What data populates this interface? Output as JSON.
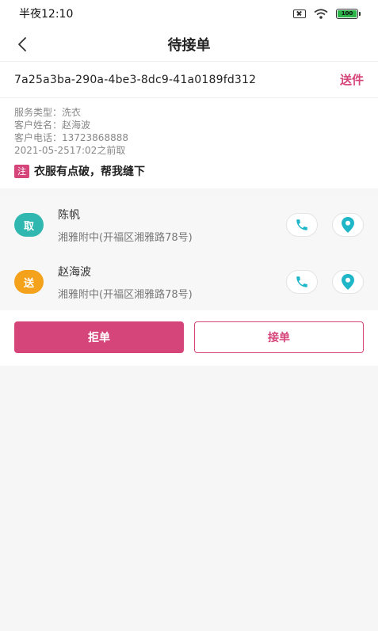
{
  "status_bar": {
    "time": "半夜12:10",
    "battery_level": 100,
    "battery_label": "100"
  },
  "header": {
    "title": "待接单"
  },
  "order": {
    "id": "7a25a3ba-290a-4be3-8dc9-41a0189fd312",
    "type": "送件",
    "service_type": "服务类型：洗衣",
    "customer_name": "客户姓名：赵海波",
    "customer_phone": "客户电话：13723868888",
    "deadline": "2021-05-2517:02之前取",
    "note_tag": "注",
    "note": "衣服有点破，帮我缝下"
  },
  "contacts": [
    {
      "badge": "取",
      "name": "陈帆",
      "address": "湘雅附中(开福区湘雅路78号)"
    },
    {
      "badge": "送",
      "name": "赵海波",
      "address": "湘雅附中(开福区湘雅路78号)"
    }
  ],
  "buttons": {
    "reject": "拒单",
    "accept": "接单"
  },
  "colors": {
    "accent": "#d6457a",
    "pickup_badge": "#2fb7b0",
    "delivery_badge": "#f4a11c",
    "action_icon": "#1fb6c8"
  },
  "icons": {
    "back": "chevron-left-icon",
    "phone": "phone-icon",
    "location": "location-pin-icon"
  }
}
